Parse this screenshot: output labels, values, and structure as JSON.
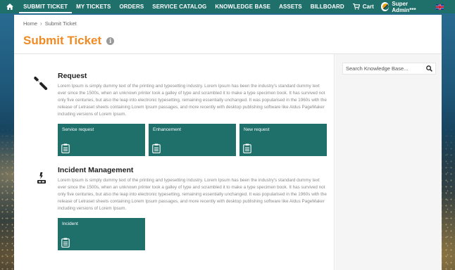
{
  "nav": {
    "home_icon": "home-icon",
    "items": [
      {
        "label": "SUBMIT TICKET",
        "active": true
      },
      {
        "label": "MY TICKETS",
        "active": false
      },
      {
        "label": "ORDERS",
        "active": false
      },
      {
        "label": "SERVICE CATALOG",
        "active": false
      },
      {
        "label": "KNOWLEDGE BASE",
        "active": false
      },
      {
        "label": "ASSETS",
        "active": false
      },
      {
        "label": "BILLBOARD",
        "active": false
      }
    ],
    "cart_label": "Cart",
    "user_name": "Super Admin***",
    "flag_icon": "uk-flag-icon"
  },
  "breadcrumb": {
    "home": "Home",
    "current": "Submit Ticket"
  },
  "page_title": "Submit Ticket",
  "search": {
    "placeholder": "Search Knowledge Base..."
  },
  "sections": [
    {
      "title": "Request",
      "icon": "wrench-icon",
      "description": "Lorem Ipsum is simply dummy text of the printing and typesetting industry. Lorem Ipsum has been the industry's standard dummy text ever since the 1500s, when an unknown printer took a galley of type and scrambled it to make a type specimen book. It has survived not only five centuries, but also the leap into electronic typesetting, remaining essentially unchanged. It was popularised in the 1960s with the release of Letraset sheets containing Lorem Ipsum passages, and more recently with desktop publishing software like Aldus PageMaker including versions of Lorem Ipsum.",
      "cards": [
        "Service request",
        "Enhancement",
        "New request"
      ]
    },
    {
      "title": "Incident Management",
      "icon": "incident-icon",
      "description": "Lorem Ipsum is simply dummy text of the printing and typesetting industry. Lorem Ipsum has been the industry's standard dummy text ever since the 1500s, when an unknown printer took a galley of type and scrambled it to make a type specimen book. It has survived not only five centuries, but also the leap into electronic typesetting, remaining essentially unchanged. It was popularised in the 1960s with the release of Letraset sheets containing Lorem Ipsum passages, and more recently with desktop publishing software like Aldus PageMaker including versions of Lorem Ipsum.",
      "cards": [
        "Incident"
      ]
    }
  ],
  "colors": {
    "accent": "#f08a24",
    "brand": "#1f6f6b"
  }
}
